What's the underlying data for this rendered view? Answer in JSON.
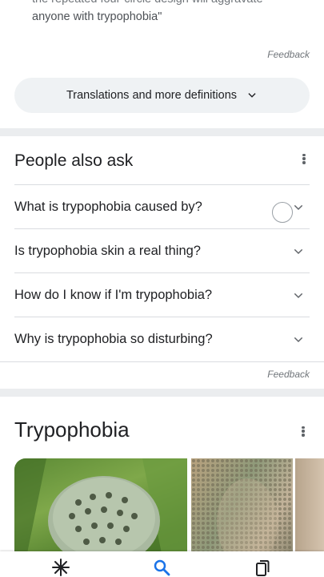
{
  "definition": {
    "quote_cut_line": "the repeated four-circle design will aggravate",
    "quote_line": "anyone with trypophobia\"",
    "feedback_label": "Feedback"
  },
  "translations_button": {
    "label": "Translations and more definitions",
    "icon": "chevron-down-icon"
  },
  "people_also_ask": {
    "title": "People also ask",
    "questions": [
      "What is trypophobia caused by?",
      "Is trypophobia skin a real thing?",
      "How do I know if I'm trypophobia?",
      "Why is trypophobia so disturbing?"
    ],
    "feedback_label": "Feedback"
  },
  "knowledge_panel": {
    "title": "Trypophobia",
    "images": [
      "lotus-seed-pod-image",
      "textured-face-sculpture-image",
      "partial-image"
    ]
  },
  "bottom_nav": {
    "icons": [
      "discover-icon",
      "search-icon",
      "collections-icon"
    ],
    "accent": "#1a73e8"
  },
  "colors": {
    "separator": "#ebedef",
    "chip_background": "#eff2f4",
    "text": "#202124",
    "muted": "#70757a"
  }
}
